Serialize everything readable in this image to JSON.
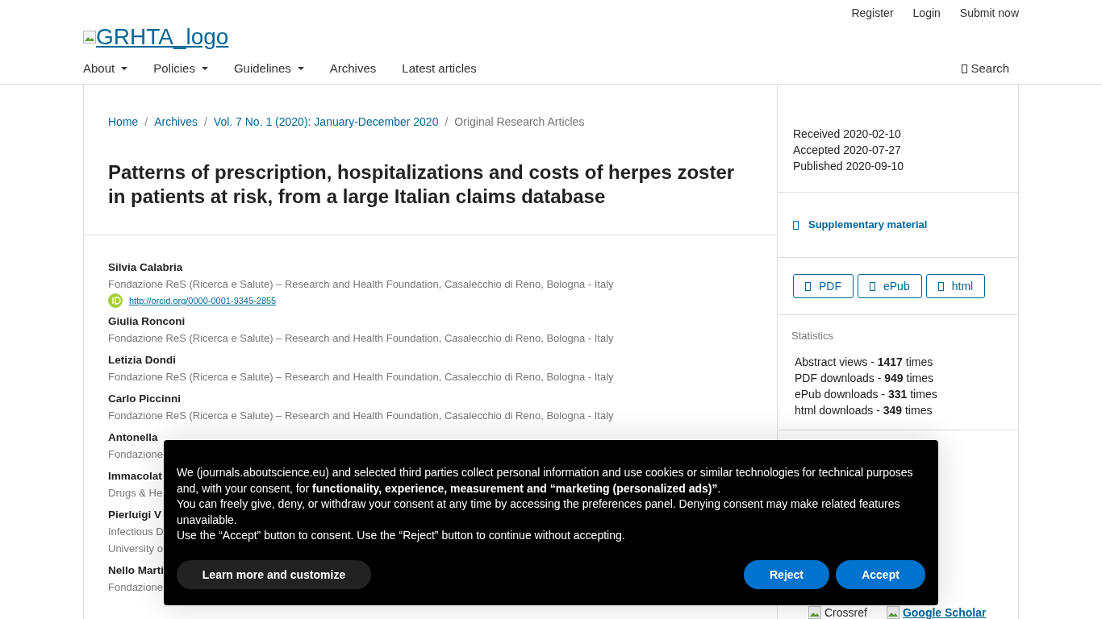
{
  "user_nav": [
    "Register",
    "Login",
    "Submit now"
  ],
  "logo": {
    "alt": "GRHTA_logo"
  },
  "nav": [
    {
      "label": "About",
      "dropdown": true
    },
    {
      "label": "Policies",
      "dropdown": true
    },
    {
      "label": "Guidelines",
      "dropdown": true
    },
    {
      "label": "Archives",
      "dropdown": false
    },
    {
      "label": "Latest articles",
      "dropdown": false
    }
  ],
  "search": {
    "label": "Search"
  },
  "breadcrumb_separator": "/",
  "breadcrumb": [
    {
      "label": "Home",
      "link": true
    },
    {
      "label": "Archives",
      "link": true
    },
    {
      "label": "Vol. 7 No. 1 (2020): January-December 2020",
      "link": true
    },
    {
      "label": "Original Research Articles",
      "link": false
    }
  ],
  "article_title": "Patterns of prescription, hospitalizations and costs of herpes zoster in patients at risk, from a large Italian claims database",
  "authors": [
    {
      "name": "Silvia Calabria",
      "affiliations": [
        "Fondazione ReS (Ricerca e Salute) – Research and Health Foundation, Casalecchio di Reno, Bologna - Italy"
      ],
      "orcid": "http://orcid.org/0000-0001-9345-2855"
    },
    {
      "name": "Giulia Ronconi",
      "affiliations": [
        "Fondazione ReS (Ricerca e Salute) – Research and Health Foundation, Casalecchio di Reno, Bologna - Italy"
      ]
    },
    {
      "name": "Letizia Dondi",
      "affiliations": [
        "Fondazione ReS (Ricerca e Salute) – Research and Health Foundation, Casalecchio di Reno, Bologna - Italy"
      ]
    },
    {
      "name": "Carlo Piccinni",
      "affiliations": [
        "Fondazione ReS (Ricerca e Salute) – Research and Health Foundation, Casalecchio di Reno, Bologna - Italy"
      ]
    },
    {
      "name": "Antonella",
      "affiliations": [
        "Fondazione"
      ]
    },
    {
      "name": "Immacolat",
      "affiliations": [
        "Drugs & He"
      ]
    },
    {
      "name": "Pierluigi V",
      "affiliations": [
        "Infectious D",
        "University o"
      ]
    },
    {
      "name": "Nello Marti",
      "affiliations": [
        "Fondazione"
      ]
    }
  ],
  "dates": [
    "Received 2020-02-10",
    "Accepted 2020-07-27",
    "Published 2020-09-10"
  ],
  "supplementary": "Supplementary material",
  "galleys": [
    "PDF",
    "ePub",
    "html"
  ],
  "statistics": {
    "title": "Statistics",
    "rows": [
      {
        "label": "Abstract views - ",
        "count": "1417",
        "unit": " times"
      },
      {
        "label": "PDF downloads - ",
        "count": "949",
        "unit": " times"
      },
      {
        "label": "ePub downloads - ",
        "count": "331",
        "unit": " times"
      },
      {
        "label": "html downloads - ",
        "count": "349",
        "unit": " times"
      }
    ]
  },
  "indexing": [
    "Crossref",
    "Google Scholar"
  ],
  "cookie_banner": {
    "paragraphs": [
      "We (journals.aboutscience.eu) and selected third parties collect personal information and use cookies or similar technologies for technical purposes and, with your consent, for **functionality, experience, measurement and “marketing (personalized ads)”**.",
      "You can freely give, deny, or withdraw your consent at any time by accessing the preferences panel. Denying consent may make related features unavailable.",
      "Use the “Accept” button to consent. Use the “Reject” button to continue without accepting."
    ],
    "customize": "Learn more and customize",
    "reject": "Reject",
    "accept": "Accept"
  }
}
